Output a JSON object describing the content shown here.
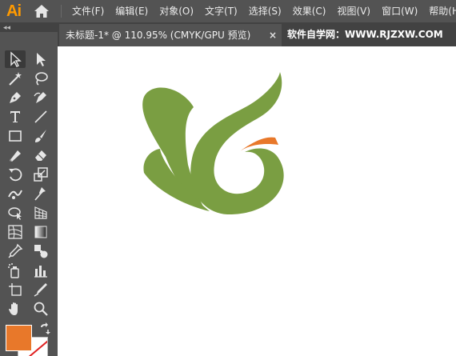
{
  "app": {
    "logo_text": "Ai"
  },
  "menu": {
    "items": [
      {
        "label": "文件(F)"
      },
      {
        "label": "编辑(E)"
      },
      {
        "label": "对象(O)"
      },
      {
        "label": "文字(T)"
      },
      {
        "label": "选择(S)"
      },
      {
        "label": "效果(C)"
      },
      {
        "label": "视图(V)"
      },
      {
        "label": "窗口(W)"
      },
      {
        "label": "帮助(H)"
      }
    ]
  },
  "tabs": {
    "collapse_label": "◂◂",
    "document_tab_title": "未标题-1* @ 110.95% (CMYK/GPU 预览)",
    "close_glyph": "×",
    "watermark": "软件自学网：WWW.RJZXW.COM"
  },
  "toolbar": {
    "tools": [
      {
        "icon": "selection-tool-icon",
        "active": true
      },
      {
        "icon": "direct-selection-tool-icon"
      },
      {
        "icon": "magic-wand-tool-icon"
      },
      {
        "icon": "lasso-tool-icon"
      },
      {
        "icon": "pen-tool-icon"
      },
      {
        "icon": "curvature-tool-icon"
      },
      {
        "icon": "type-tool-icon"
      },
      {
        "icon": "line-segment-tool-icon"
      },
      {
        "icon": "rectangle-tool-icon"
      },
      {
        "icon": "paintbrush-tool-icon"
      },
      {
        "icon": "shaper-tool-icon"
      },
      {
        "icon": "eraser-tool-icon"
      },
      {
        "icon": "rotate-tool-icon"
      },
      {
        "icon": "scale-tool-icon"
      },
      {
        "icon": "width-tool-icon"
      },
      {
        "icon": "puppet-warp-tool-icon"
      },
      {
        "icon": "shape-builder-tool-icon"
      },
      {
        "icon": "perspective-grid-tool-icon"
      },
      {
        "icon": "mesh-tool-icon"
      },
      {
        "icon": "gradient-tool-icon"
      },
      {
        "icon": "eyedropper-tool-icon"
      },
      {
        "icon": "blend-tool-icon"
      },
      {
        "icon": "symbol-sprayer-tool-icon"
      },
      {
        "icon": "column-graph-tool-icon"
      },
      {
        "icon": "artboard-tool-icon"
      },
      {
        "icon": "slice-tool-icon"
      },
      {
        "icon": "hand-tool-icon"
      },
      {
        "icon": "zoom-tool-icon"
      }
    ],
    "fill_color": "#e8782a",
    "stroke_color": "none"
  },
  "artwork": {
    "green": "#7a9e42",
    "orange": "#e8782a"
  }
}
